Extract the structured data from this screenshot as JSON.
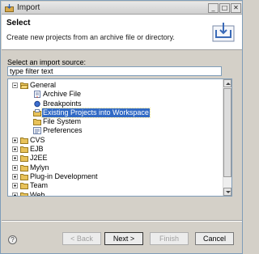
{
  "window": {
    "title": "Import",
    "title_buttons": {
      "minimize": "_",
      "maximize": "□",
      "close": "✕"
    },
    "icon": "import-icon"
  },
  "header": {
    "title": "Select",
    "description": "Create new projects from an archive file or directory.",
    "icon": "import-wizard-icon"
  },
  "source": {
    "label": "Select an import source:",
    "filter_value": "type filter text"
  },
  "tree": {
    "items": [
      {
        "label": "General",
        "icon": "folder-open-icon",
        "expander": "minus",
        "level": 0
      },
      {
        "label": "Archive File",
        "icon": "archive-file-icon",
        "level": 1
      },
      {
        "label": "Breakpoints",
        "icon": "breakpoints-icon",
        "level": 1
      },
      {
        "label": "Existing Projects into Workspace",
        "icon": "projects-icon",
        "level": 1,
        "selected": true
      },
      {
        "label": "File System",
        "icon": "folder-icon",
        "level": 1
      },
      {
        "label": "Preferences",
        "icon": "preferences-icon",
        "level": 1
      },
      {
        "label": "CVS",
        "icon": "folder-icon",
        "expander": "plus",
        "level": 0
      },
      {
        "label": "EJB",
        "icon": "folder-icon",
        "expander": "plus",
        "level": 0
      },
      {
        "label": "J2EE",
        "icon": "folder-icon",
        "expander": "plus",
        "level": 0
      },
      {
        "label": "Mylyn",
        "icon": "folder-icon",
        "expander": "plus",
        "level": 0
      },
      {
        "label": "Plug-in Development",
        "icon": "folder-icon",
        "expander": "plus",
        "level": 0
      },
      {
        "label": "Team",
        "icon": "folder-icon",
        "expander": "plus",
        "level": 0
      },
      {
        "label": "Web",
        "icon": "folder-icon",
        "expander": "plus",
        "level": 0
      }
    ]
  },
  "footer": {
    "help_label": "?",
    "back_label": "< Back",
    "next_label": "Next >",
    "finish_label": "Finish",
    "cancel_label": "Cancel"
  },
  "colors": {
    "selection": "#316ac5",
    "folder": "#e8c25a",
    "dialog_bg": "#d4d0c8"
  }
}
